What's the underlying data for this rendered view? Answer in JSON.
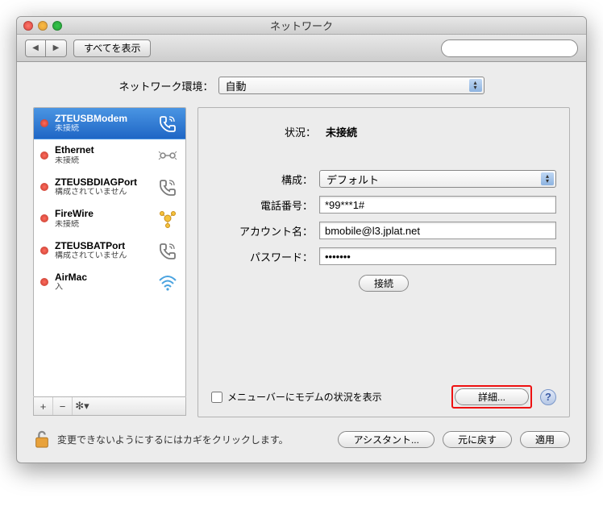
{
  "window": {
    "title": "ネットワーク"
  },
  "toolbar": {
    "show_all": "すべてを表示",
    "search_placeholder": ""
  },
  "location": {
    "label": "ネットワーク環境：",
    "value": "自動"
  },
  "sidebar": {
    "items": [
      {
        "name": "ZTEUSBModem",
        "status": "未接続",
        "selected": true,
        "dot": "red",
        "icon": "phone"
      },
      {
        "name": "Ethernet",
        "status": "未接続",
        "selected": false,
        "dot": "red",
        "icon": "ethernet"
      },
      {
        "name": "ZTEUSBDIAGPort",
        "status": "構成されていません",
        "selected": false,
        "dot": "red",
        "icon": "phone"
      },
      {
        "name": "FireWire",
        "status": "未接続",
        "selected": false,
        "dot": "red",
        "icon": "firewire"
      },
      {
        "name": "ZTEUSBATPort",
        "status": "構成されていません",
        "selected": false,
        "dot": "red",
        "icon": "phone"
      },
      {
        "name": "AirMac",
        "status": "入",
        "selected": false,
        "dot": "red",
        "icon": "wifi"
      }
    ]
  },
  "detail": {
    "status_label": "状況：",
    "status_value": "未接続",
    "config_label": "構成：",
    "config_value": "デフォルト",
    "phone_label": "電話番号：",
    "phone_value": "*99***1#",
    "account_label": "アカウント名：",
    "account_value": "bmobile@l3.jplat.net",
    "password_label": "パスワード：",
    "password_value": "•••••••",
    "connect_label": "接続",
    "menubar_label": "メニューバーにモデムの状況を表示",
    "advanced_label": "詳細..."
  },
  "footer": {
    "lock_text": "変更できないようにするにはカギをクリックします。",
    "assistant": "アシスタント...",
    "revert": "元に戻す",
    "apply": "適用"
  }
}
